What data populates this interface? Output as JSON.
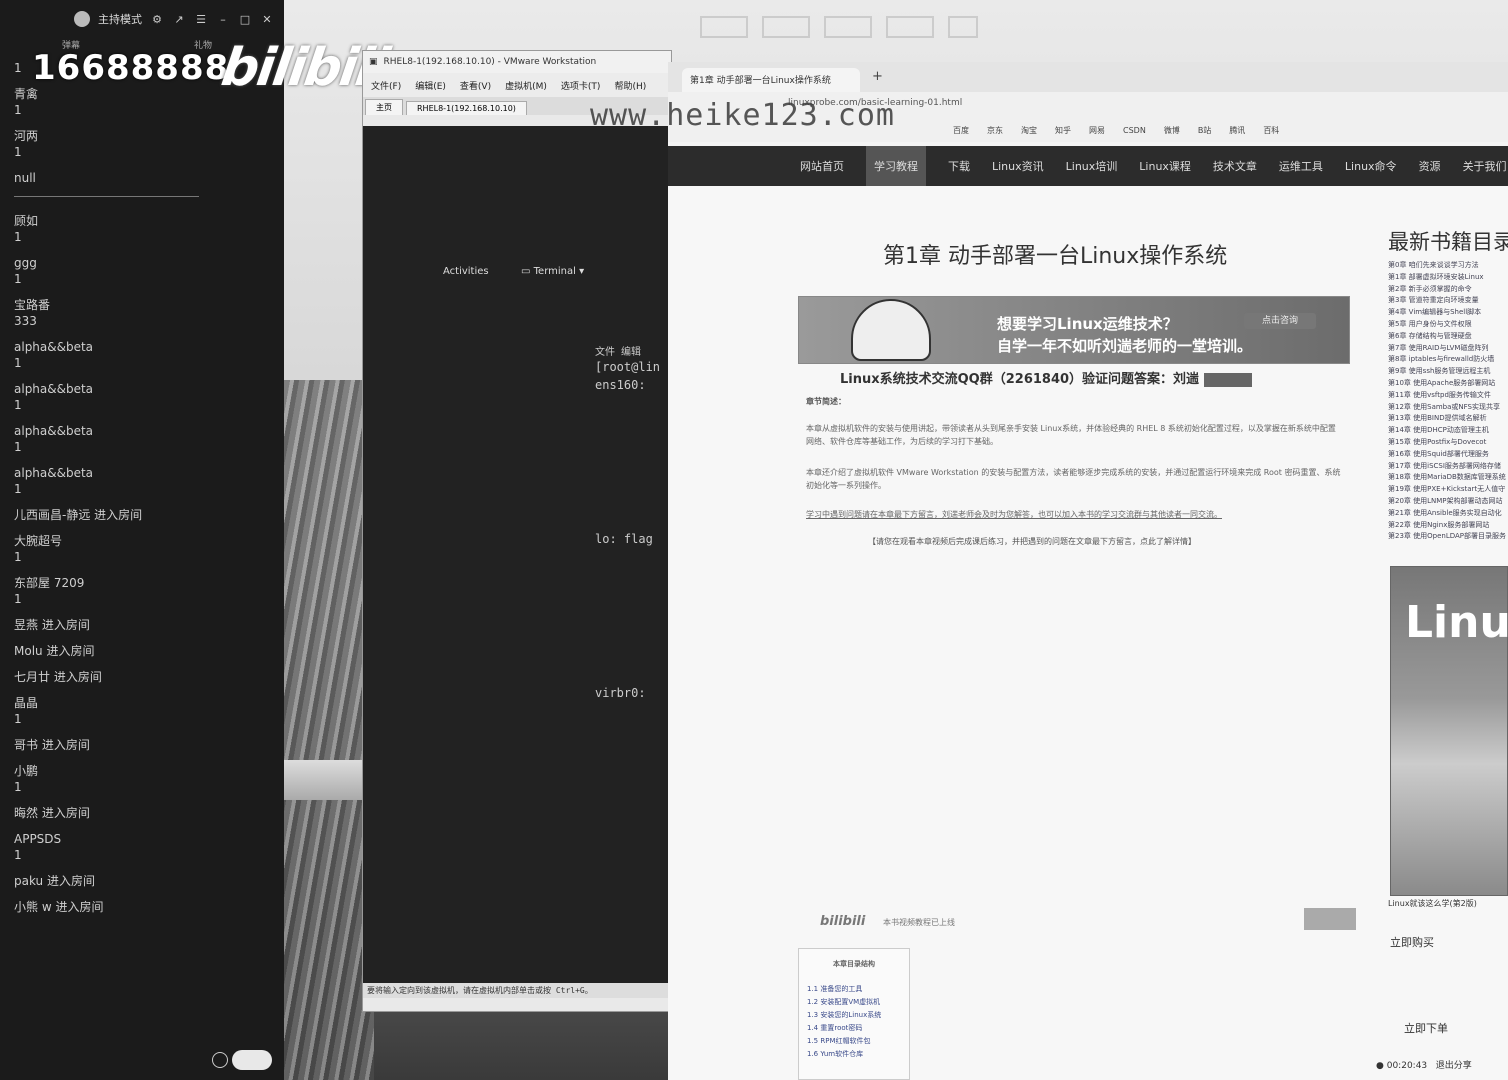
{
  "chat": {
    "topbar_title": "主持模式",
    "tab_left": "弹幕",
    "tab_right": "礼物",
    "messages": [
      {
        "name": "1",
        "text": ""
      },
      {
        "name": "青禽",
        "text": "1"
      },
      {
        "name": "河两",
        "text": "1"
      },
      {
        "name": "null",
        "text": ""
      },
      {
        "name": "顾如",
        "text": "1"
      },
      {
        "name": "ggg",
        "text": "1"
      },
      {
        "name": "宝路番",
        "text": "333"
      },
      {
        "name": "alpha&&beta",
        "text": "1"
      },
      {
        "name": "alpha&&beta",
        "text": "1"
      },
      {
        "name": "alpha&&beta",
        "text": "1"
      },
      {
        "name": "alpha&&beta",
        "text": "1"
      },
      {
        "name": "儿西画昌-静远 进入房间",
        "text": ""
      },
      {
        "name": "大腕超号",
        "text": "1"
      },
      {
        "name": "东部屋 7209",
        "text": "1"
      },
      {
        "name": "昱燕 进入房间",
        "text": ""
      },
      {
        "name": "Molu 进入房间",
        "text": ""
      },
      {
        "name": "七月廿 进入房间",
        "text": ""
      },
      {
        "name": "晶晶",
        "text": "1"
      },
      {
        "name": "哥书 进入房间",
        "text": ""
      },
      {
        "name": "小鹏",
        "text": "1"
      },
      {
        "name": "晦然 进入房间",
        "text": ""
      },
      {
        "name": "APPSDS",
        "text": "1"
      },
      {
        "name": "paku 进入房间",
        "text": ""
      },
      {
        "name": "小熊 w 进入房间",
        "text": ""
      }
    ]
  },
  "overlay": {
    "number": "16688888",
    "logo": "bilibili"
  },
  "vmware": {
    "title": "RHEL8-1(192.168.10.10) - VMware Workstation",
    "menus": [
      "文件(F)",
      "编辑(E)",
      "查看(V)",
      "虚拟机(M)",
      "选项卡(T)",
      "帮助(H)"
    ],
    "tabs": [
      "主页",
      "RHEL8-1(192.168.10.10)"
    ],
    "activities": "Activities",
    "terminal": "Terminal",
    "term_lines": [
      "文件 编辑",
      "[root@lin",
      "ens160:",
      "lo: flag",
      "virbr0:"
    ],
    "status": "要将输入定向到该虚拟机，请在虚拟机内部单击或按 Ctrl+G。"
  },
  "watermark": "www.heike123.com",
  "browser": {
    "tab_title": "第1章 动手部署一台Linux操作系统",
    "address": "linuxprobe.com/basic-learning-01.html",
    "bookmarks": [
      "百度",
      "京东",
      "淘宝",
      "知乎",
      "网易",
      "CSDN",
      "微博",
      "B站",
      "腾讯",
      "百科"
    ],
    "nav": [
      "网站首页",
      "学习教程",
      "下载",
      "Linux资讯",
      "Linux培训",
      "Linux课程",
      "技术文章",
      "运维工具",
      "Linux命令",
      "资源",
      "关于我们"
    ],
    "active_nav_index": 1
  },
  "article": {
    "title": "第1章 动手部署一台Linux操作系统",
    "banner_line1": "想要学习Linux运维技术？",
    "banner_line2": "自学一年不如听刘遄老师的一堂培训。",
    "banner_button": "点击咨询",
    "qq_line": "Linux系统技术交流QQ群（2261840）验证问题答案：刘遄",
    "section_label": "章节简述：",
    "para1": "本章从虚拟机软件的安装与使用讲起，带领读者从头到尾亲手安装 Linux系统，并体验经典的 RHEL 8 系统初始化配置过程，以及掌握在新系统中配置网络、软件仓库等基础工作，为后续的学习打下基础。",
    "para2": "本章还介绍了虚拟机软件 VMware Workstation 的安装与配置方法，读者能够逐步完成系统的安装，并通过配置运行环境来完成 Root 密码重置、系统初始化等一系列操作。",
    "para3": "学习中遇到问题请在本章最下方留言，刘遄老师会及时为您解答，也可以加入本书的学习交流群与其他读者一同交流。",
    "note": "【请您在观看本章视频后完成课后练习，并把遇到的问题在文章最下方留言，点此了解详情】",
    "video_logo": "bilibili",
    "video_text": "本书视频教程已上线",
    "toc_title": "本章目录结构",
    "toc": [
      "1.1 准备您的工具",
      "1.2 安装配置VM虚拟机",
      "1.3 安装您的Linux系统",
      "1.4 重置root密码",
      "1.5 RPM红帽软件包",
      "1.6 Yum软件仓库"
    ]
  },
  "sidebar": {
    "heading": "最新书籍目录",
    "items": [
      "第0章 咱们先来谈谈学习方法",
      "第1章 部署虚拟环境安装Linux",
      "第2章 新手必须掌握的命令",
      "第3章 管道符重定向环境变量",
      "第4章 Vim编辑器与Shell脚本",
      "第5章 用户身份与文件权限",
      "第6章 存储结构与管理硬盘",
      "第7章 使用RAID与LVM磁盘阵列",
      "第8章 iptables与firewalld防火墙",
      "第9章 使用ssh服务管理远程主机",
      "第10章 使用Apache服务部署网站",
      "第11章 使用vsftpd服务传输文件",
      "第12章 使用Samba或NFS实现共享",
      "第13章 使用BIND提供域名解析",
      "第14章 使用DHCP动态管理主机",
      "第15章 使用Postfix与Dovecot",
      "第16章 使用Squid部署代理服务",
      "第17章 使用iSCSI服务部署网络存储",
      "第18章 使用MariaDB数据库管理系统",
      "第19章 使用PXE+Kickstart无人值守",
      "第20章 使用LNMP架构部署动态网站",
      "第21章 使用Ansible服务实现自动化",
      "第22章 使用Nginx服务部署网站",
      "第23章 使用OpenLDAP部署目录服务"
    ],
    "book_title": "Linux",
    "book_caption": "Linux就该这么学(第2版)",
    "btn1": "立即购买",
    "btn2": "立即下单",
    "share_time": "00:20:43",
    "share_exit": "退出分享"
  }
}
